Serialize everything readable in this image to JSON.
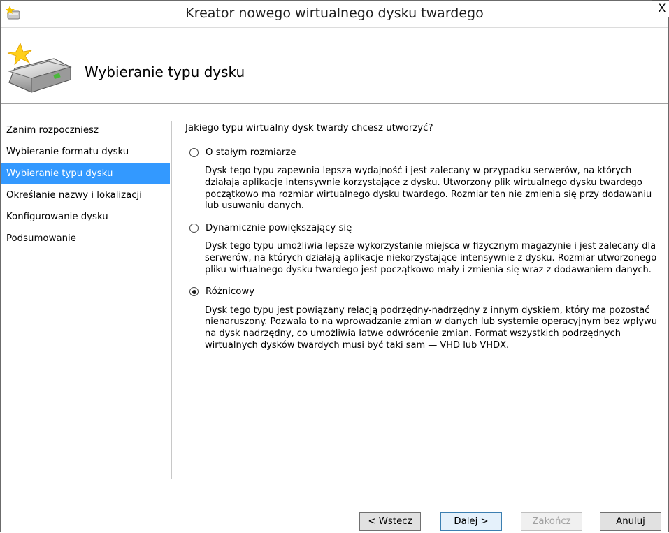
{
  "window": {
    "title": "Kreator nowego wirtualnego dysku twardego",
    "close_glyph": "X"
  },
  "header": {
    "title": "Wybieranie typu dysku"
  },
  "nav": {
    "items": [
      {
        "label": "Zanim rozpoczniesz"
      },
      {
        "label": "Wybieranie formatu dysku"
      },
      {
        "label": "Wybieranie typu dysku"
      },
      {
        "label": "Określanie nazwy i lokalizacji"
      },
      {
        "label": "Konfigurowanie dysku"
      },
      {
        "label": "Podsumowanie"
      }
    ],
    "active_index": 2,
    "active_color": "#3399ff"
  },
  "main": {
    "question": "Jakiego typu wirtualny dysk twardy chcesz utworzyć?",
    "options": [
      {
        "label": "O stałym rozmiarze",
        "checked": false,
        "description": "Dysk tego typu zapewnia lepszą wydajność i jest zalecany w przypadku serwerów, na których działają aplikacje intensywnie korzystające z dysku. Utworzony plik wirtualnego dysku twardego początkowo ma rozmiar wirtualnego dysku twardego. Rozmiar ten nie zmienia się przy dodawaniu lub usuwaniu danych."
      },
      {
        "label": "Dynamicznie powiększający się",
        "checked": false,
        "description": "Dysk tego typu umożliwia lepsze wykorzystanie miejsca w fizycznym magazynie i jest zalecany dla serwerów, na których działają aplikacje niekorzystające intensywnie z dysku. Rozmiar utworzonego pliku wirtualnego dysku twardego jest początkowo mały i zmienia się wraz z dodawaniem danych."
      },
      {
        "label": "Różnicowy",
        "checked": true,
        "description": "Dysk tego typu jest powiązany relacją podrzędny-nadrzędny z innym dyskiem, który ma pozostać nienaruszony. Pozwala to na wprowadzanie zmian w danych lub systemie operacyjnym bez wpływu na dysk nadrzędny, co umożliwia łatwe odwrócenie zmian. Format wszystkich podrzędnych wirtualnych dysków twardych musi być taki sam — VHD lub VHDX."
      }
    ]
  },
  "buttons": {
    "back": "< Wstecz",
    "next": "Dalej >",
    "finish": "Zakończ",
    "cancel": "Anuluj"
  }
}
